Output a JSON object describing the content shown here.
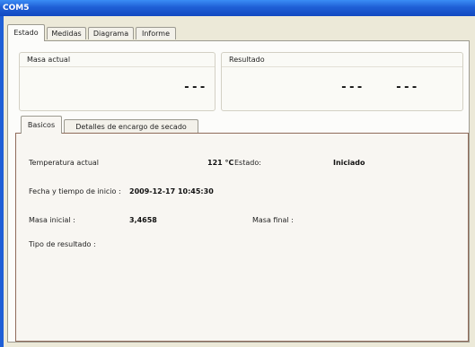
{
  "window": {
    "title": "COM5"
  },
  "tabs": [
    {
      "label": "Estado"
    },
    {
      "label": "Medidas"
    },
    {
      "label": "Diagrama"
    },
    {
      "label": "Informe"
    }
  ],
  "masa_actual": {
    "label": "Masa actual",
    "value": "---"
  },
  "resultado": {
    "label": "Resultado",
    "value1": "---",
    "value2": "---"
  },
  "inner_tabs": [
    {
      "label": "Basicos"
    },
    {
      "label": "Detalles de encargo de secado"
    }
  ],
  "basicos": {
    "temperatura_label": "Temperatura actual",
    "temperatura_value": "121 °C",
    "estado_label": "Estado:",
    "estado_value": "Iniciado",
    "fecha_label": "Fecha y tiempo de inicio :",
    "fecha_value": "2009-12-17 10:45:30",
    "masa_inicial_label": "Masa inicial :",
    "masa_inicial_value": "3,4658",
    "masa_final_label": "Masa final :",
    "tipo_resultado_label": "Tipo de resultado :"
  },
  "colors": {
    "titlebar": "#1f5fd6",
    "window_bg": "#ece9d8",
    "panel_border": "#8f6b5a"
  }
}
